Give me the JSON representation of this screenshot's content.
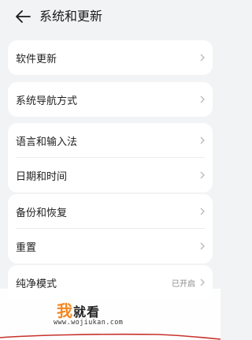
{
  "header": {
    "back_icon": "arrow-left-icon",
    "title": "系统和更新"
  },
  "groups": [
    {
      "items": [
        {
          "label": "软件更新"
        }
      ]
    },
    {
      "items": [
        {
          "label": "系统导航方式"
        }
      ]
    },
    {
      "items": [
        {
          "label": "语言和输入法"
        },
        {
          "label": "日期和时间"
        }
      ]
    },
    {
      "items": [
        {
          "label": "备份和恢复"
        },
        {
          "label": "重置"
        }
      ]
    },
    {
      "items": [
        {
          "label": "纯净模式",
          "value": "已开启"
        }
      ]
    }
  ],
  "watermark": {
    "title_chars": [
      "我",
      "就",
      "看"
    ],
    "url": "www.wojiukan.com",
    "accent_color": "#f5871f"
  },
  "colors": {
    "background": "#f1f3f5",
    "card": "#ffffff",
    "text": "#1f1f1f",
    "secondary_text": "#8a8a8a",
    "chevron": "#b8b8b8"
  }
}
